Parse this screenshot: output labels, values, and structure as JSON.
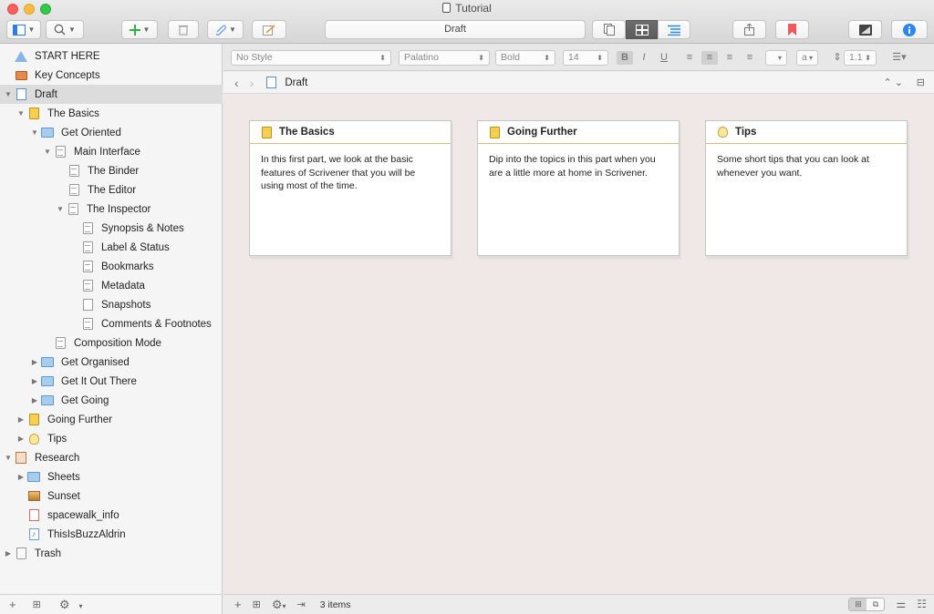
{
  "window": {
    "title": "Tutorial"
  },
  "toolbar": {
    "document_path": "Draft"
  },
  "binder": {
    "items": [
      {
        "label": "START HERE"
      },
      {
        "label": "Key Concepts"
      },
      {
        "label": "Draft"
      },
      {
        "label": "The Basics"
      },
      {
        "label": "Get Oriented"
      },
      {
        "label": "Main Interface"
      },
      {
        "label": "The Binder"
      },
      {
        "label": "The Editor"
      },
      {
        "label": "The Inspector"
      },
      {
        "label": "Synopsis & Notes"
      },
      {
        "label": "Label & Status"
      },
      {
        "label": "Bookmarks"
      },
      {
        "label": "Metadata"
      },
      {
        "label": "Snapshots"
      },
      {
        "label": "Comments & Footnotes"
      },
      {
        "label": "Composition Mode"
      },
      {
        "label": "Get Organised"
      },
      {
        "label": "Get It Out There"
      },
      {
        "label": "Get Going"
      },
      {
        "label": "Going Further"
      },
      {
        "label": "Tips"
      },
      {
        "label": "Research"
      },
      {
        "label": "Sheets"
      },
      {
        "label": "Sunset"
      },
      {
        "label": "spacewalk_info"
      },
      {
        "label": "ThisIsBuzzAldrin"
      },
      {
        "label": "Trash"
      }
    ]
  },
  "format_bar": {
    "paragraph_style": "No Style",
    "font_family": "Palatino",
    "font_weight": "Bold",
    "font_size": "14",
    "line_spacing": "1.1",
    "text_color_label": "a"
  },
  "header": {
    "title": "Draft"
  },
  "corkboard": {
    "cards": [
      {
        "title": "The Basics",
        "synopsis": "In this first part, we look at the basic features of Scrivener that you will be using most of the time."
      },
      {
        "title": "Going Further",
        "synopsis": "Dip into the topics in this part when you are a little more at home in Scrivener."
      },
      {
        "title": "Tips",
        "synopsis": "Some short tips that you can look at whenever you want."
      }
    ]
  },
  "status": {
    "item_count": "3 items"
  },
  "colors": {
    "corkboard_bg": "#efe8e6",
    "card_title_rule": "#e5b979",
    "bookmark_red": "#f0595c",
    "info_blue": "#2a86f0",
    "add_green": "#2fb04a"
  }
}
